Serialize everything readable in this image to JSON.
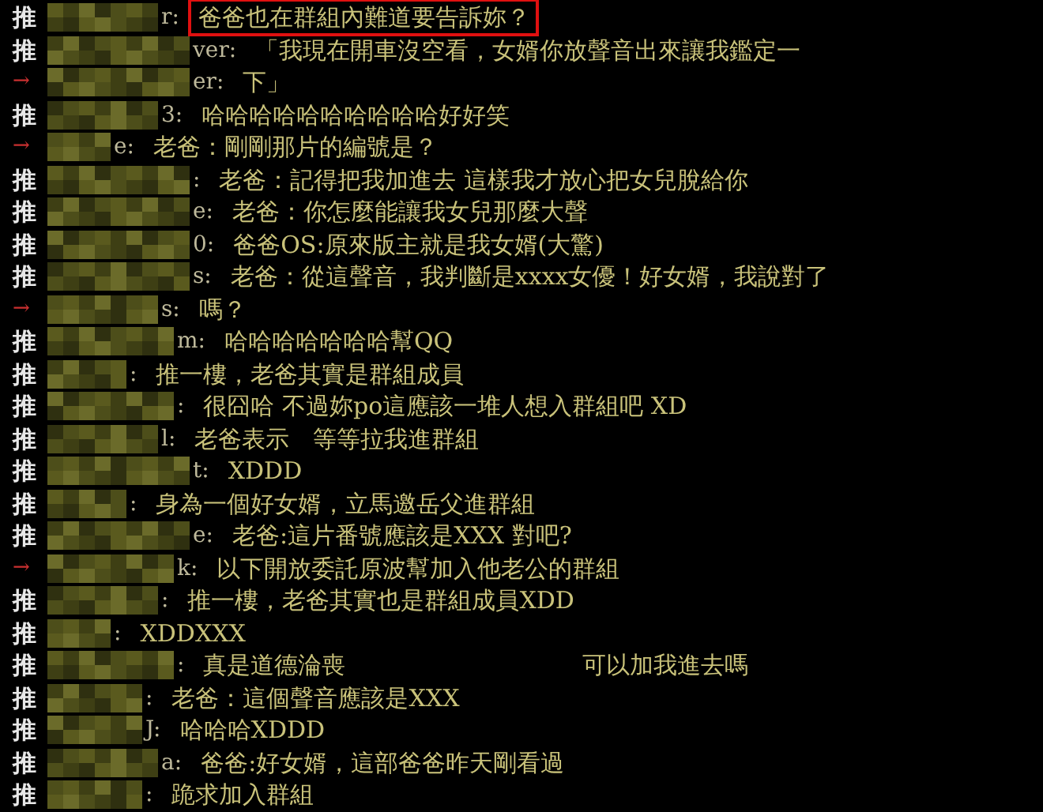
{
  "comments": [
    {
      "tag": "推",
      "kind": "push",
      "tail": "r:",
      "text": "爸爸也在群組內難道要告訴妳？",
      "highlighted": true
    },
    {
      "tag": "推",
      "kind": "push",
      "tail": "ver:",
      "text": "「我現在開車沒空看，女婿你放聲音出來讓我鑑定一",
      "highlighted": false
    },
    {
      "tag": "→",
      "kind": "arrow",
      "tail": "er:",
      "text": "下」",
      "highlighted": false
    },
    {
      "tag": "推",
      "kind": "push",
      "tail": "3:",
      "text": "哈哈哈哈哈哈哈哈哈哈好好笑",
      "highlighted": false
    },
    {
      "tag": "→",
      "kind": "arrow",
      "tail": "e:",
      "text": "老爸：剛剛那片的編號是？",
      "highlighted": false
    },
    {
      "tag": "推",
      "kind": "push",
      "tail": ":",
      "text": "老爸：記得把我加進去 這樣我才放心把女兒脫給你",
      "highlighted": false
    },
    {
      "tag": "推",
      "kind": "push",
      "tail": "e:",
      "text": "老爸：你怎麼能讓我女兒那麼大聲",
      "highlighted": false
    },
    {
      "tag": "推",
      "kind": "push",
      "tail": "0:",
      "text": "爸爸OS:原來版主就是我女婿(大驚)",
      "highlighted": false
    },
    {
      "tag": "推",
      "kind": "push",
      "tail": "s:",
      "text": "老爸：從這聲音，我判斷是xxxx女優！好女婿，我說對了",
      "highlighted": false
    },
    {
      "tag": "→",
      "kind": "arrow",
      "tail": "s:",
      "text": "嗎？",
      "highlighted": false
    },
    {
      "tag": "推",
      "kind": "push",
      "tail": "m:",
      "text": "哈哈哈哈哈哈哈幫QQ",
      "highlighted": false
    },
    {
      "tag": "推",
      "kind": "push",
      "tail": ":",
      "text": "推一樓，老爸其實是群組成員",
      "highlighted": false
    },
    {
      "tag": "推",
      "kind": "push",
      "tail": ":",
      "text": "很囧哈 不過妳po這應該一堆人想入群組吧 XD",
      "highlighted": false
    },
    {
      "tag": "推",
      "kind": "push",
      "tail": "l:",
      "text": "老爸表示　等等拉我進群組",
      "highlighted": false
    },
    {
      "tag": "推",
      "kind": "push",
      "tail": "t:",
      "text": "XDDD",
      "highlighted": false
    },
    {
      "tag": "推",
      "kind": "push",
      "tail": ":",
      "text": "身為一個好女婿，立馬邀岳父進群組",
      "highlighted": false
    },
    {
      "tag": "推",
      "kind": "push",
      "tail": "e:",
      "text": "老爸:這片番號應該是XXX 對吧?",
      "highlighted": false
    },
    {
      "tag": "→",
      "kind": "arrow",
      "tail": "k:",
      "text": "以下開放委託原波幫加入他老公的群組",
      "highlighted": false
    },
    {
      "tag": "推",
      "kind": "push",
      "tail": ":",
      "text": "推一樓，老爸其實也是群組成員XDD",
      "highlighted": false
    },
    {
      "tag": "推",
      "kind": "push",
      "tail": ":",
      "text": "XDDXXX",
      "highlighted": false
    },
    {
      "tag": "推",
      "kind": "push",
      "tail": ":",
      "text": "真是道德淪喪　　　　　　　　　　可以加我進去嗎",
      "highlighted": false
    },
    {
      "tag": "推",
      "kind": "push",
      "tail": ":",
      "text": "老爸：這個聲音應該是XXX",
      "highlighted": false
    },
    {
      "tag": "推",
      "kind": "push",
      "tail": "J:",
      "text": "哈哈哈XDDD",
      "highlighted": false
    },
    {
      "tag": "推",
      "kind": "push",
      "tail": "a:",
      "text": "爸爸:好女婿，這部爸爸昨天剛看過",
      "highlighted": false
    },
    {
      "tag": "推",
      "kind": "push",
      "tail": ":",
      "text": "跪求加入群組",
      "highlighted": false
    }
  ]
}
